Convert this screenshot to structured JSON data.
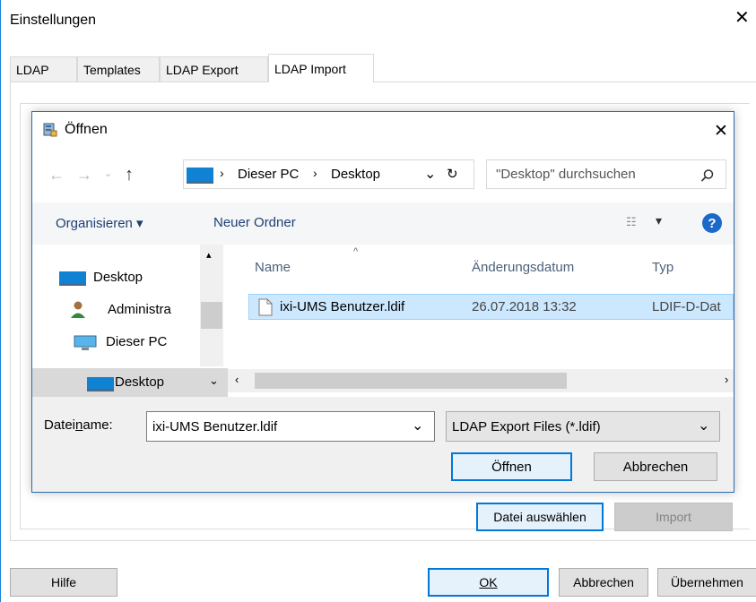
{
  "outer": {
    "title": "Einstellungen",
    "tabs": [
      "LDAP",
      "Templates",
      "LDAP Export",
      "LDAP Import"
    ],
    "active_tab": "LDAP Import",
    "select_file_label": "Datei auswählen",
    "import_label": "Import",
    "help_label": "Hilfe",
    "ok_label": "OK",
    "cancel_label": "Abbrechen",
    "apply_label": "Übernehmen"
  },
  "dialog": {
    "title": "Öffnen",
    "breadcrumb": [
      "Dieser PC",
      "Desktop"
    ],
    "search_placeholder": "\"Desktop\" durchsuchen",
    "organize_label": "Organisieren ▾",
    "new_folder_label": "Neuer Ordner",
    "help_glyph": "?",
    "nav_items": [
      {
        "label": "Desktop",
        "icon": "desktop-icon"
      },
      {
        "label": "Administra",
        "icon": "user-icon"
      },
      {
        "label": "Dieser PC",
        "icon": "pc-icon"
      },
      {
        "label": "Desktop",
        "icon": "desktop-icon",
        "selected": true
      }
    ],
    "columns": [
      "Name",
      "Änderungsdatum",
      "Typ"
    ],
    "files": [
      {
        "name": "ixi-UMS Benutzer.ldif",
        "date": "26.07.2018 13:32",
        "type": "LDIF-D-Dat",
        "selected": true
      }
    ],
    "filename_label_pre": "Datei",
    "filename_label_acc": "n",
    "filename_label_post": "ame:",
    "filename_value": "ixi-UMS Benutzer.ldif",
    "filter_value": "LDAP Export Files (*.ldif)",
    "open_label": "Öffnen",
    "cancel_label": "Abbrechen"
  },
  "colors": {
    "accent": "#0078d7",
    "selection": "#cce8ff",
    "help_blue": "#1b6ac9",
    "link_blue": "#1e3f73"
  }
}
